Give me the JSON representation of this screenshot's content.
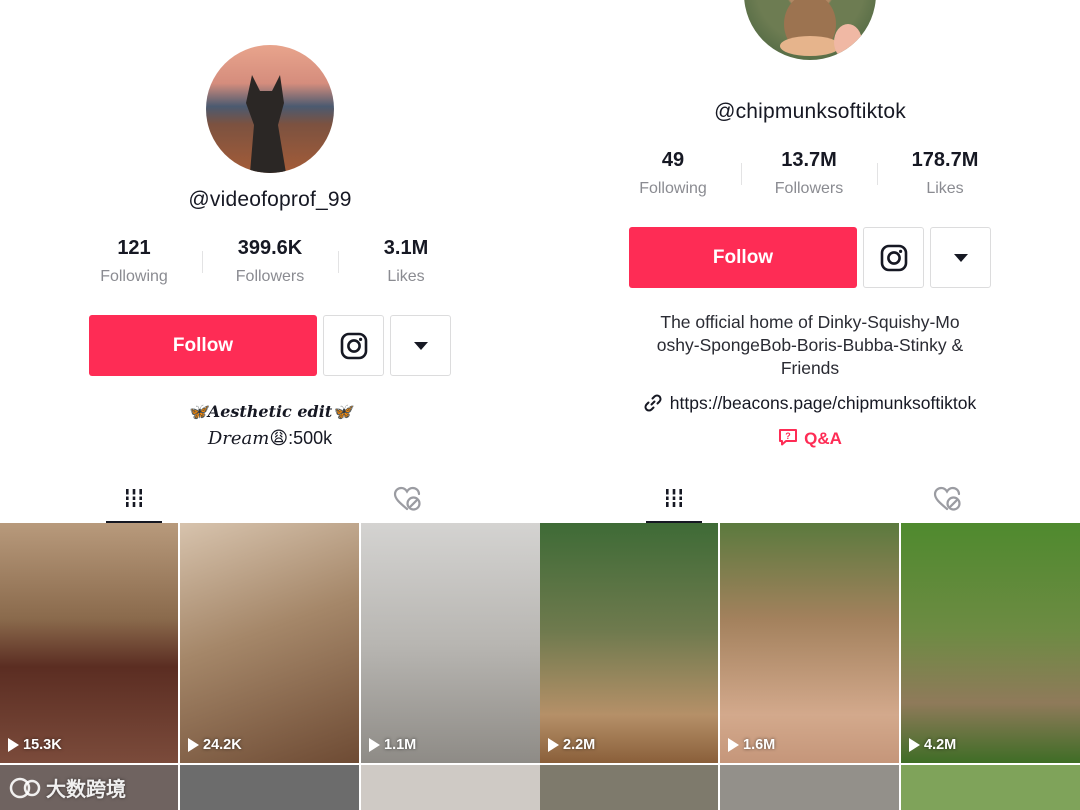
{
  "left": {
    "handle": "@videofoprof_99",
    "stats": [
      {
        "value": "121",
        "label": "Following"
      },
      {
        "value": "399.6K",
        "label": "Followers"
      },
      {
        "value": "3.1M",
        "label": "Likes"
      }
    ],
    "follow_label": "Follow",
    "bio_line1": "🦋Aesthetic edit🦋",
    "bio_line2_italic": "Dream",
    "bio_line2_emoji": "😩",
    "bio_line2_rest": ":500k",
    "videos": [
      "15.3K",
      "24.2K",
      "1.1M"
    ]
  },
  "right": {
    "handle": "@chipmunksoftiktok",
    "stats": [
      {
        "value": "49",
        "label": "Following"
      },
      {
        "value": "13.7M",
        "label": "Followers"
      },
      {
        "value": "178.7M",
        "label": "Likes"
      }
    ],
    "follow_label": "Follow",
    "bio_lines": [
      "The official home of Dinky-Squishy-Mo",
      "oshy-SpongeBob-Boris-Bubba-Stinky &",
      "Friends"
    ],
    "link": "https://beacons.page/chipmunksoftiktok",
    "qa_label": "Q&A",
    "videos": [
      "2.2M",
      "1.6M",
      "4.2M"
    ]
  },
  "watermark": "大数跨境",
  "icons": {
    "instagram": "instagram-icon",
    "dropdown": "triangle-down-icon",
    "grid": "grid-icon",
    "liked": "heart-hidden-icon",
    "link": "link-icon",
    "qa": "qa-icon",
    "play": "play-icon"
  },
  "colors": {
    "accent": "#fe2c55",
    "text": "#161823",
    "muted": "#8a8b91"
  }
}
